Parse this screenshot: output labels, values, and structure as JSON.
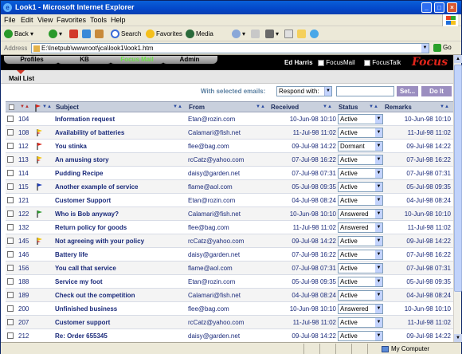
{
  "window": {
    "title": "Look1 - Microsoft Internet Explorer"
  },
  "menu": [
    "File",
    "Edit",
    "View",
    "Favorites",
    "Tools",
    "Help"
  ],
  "toolbar": {
    "back": "Back",
    "search": "Search",
    "favorites": "Favorites",
    "media": "Media"
  },
  "address": {
    "label": "Address",
    "url": "E:\\Inetpub\\wwwroot\\jca\\look1\\look1.htm",
    "go": "Go"
  },
  "app": {
    "tabs": [
      "Profiles",
      "KB",
      "Focus Mail",
      "Admin"
    ],
    "active_tab": "Focus Mail",
    "user": "Ed Harris",
    "links": [
      "FocusMail",
      "FocusTalk"
    ],
    "logo": "Focus",
    "section": "Mail List",
    "with_selected": "With selected emails:",
    "respond_select": "Respond with:",
    "set_button": "Set...",
    "doit_button": "Do It"
  },
  "columns": {
    "subject": "Subject",
    "from": "From",
    "received": "Received",
    "status": "Status",
    "remarks": "Remarks"
  },
  "colors": {
    "flag_red": "#d8261b",
    "flag_yellow": "#f2c200",
    "flag_blue": "#1a3ab8",
    "flag_green": "#2a9a2a",
    "header_bg": "#c9d0dd",
    "accent_link": "#1a2a7a"
  },
  "emails": [
    {
      "id": "104",
      "flag": "",
      "subject": "Information request",
      "from": "Etan@rozin.com",
      "received": "10-Jun-98 10:10",
      "status": "Active",
      "remarks": "10-Jun-98 10:10"
    },
    {
      "id": "108",
      "flag": "yellow-red",
      "subject": "Availability of batteries",
      "from": "Calamari@fish.net",
      "received": "11-Jul-98 11:02",
      "status": "Active",
      "remarks": "11-Jul-98 11:02"
    },
    {
      "id": "112",
      "flag": "red",
      "subject": "You stinka",
      "from": "flee@bag.com",
      "received": "09-Jul-98 14:22",
      "status": "Dormant",
      "remarks": "09-Jul-98 14:22"
    },
    {
      "id": "113",
      "flag": "yellow-red",
      "subject": "An amusing story",
      "from": "rcCatz@yahoo.com",
      "received": "07-Jul-98 16:22",
      "status": "Active",
      "remarks": "07-Jul-98 16:22"
    },
    {
      "id": "114",
      "flag": "",
      "subject": "Pudding Recipe",
      "from": "daisy@garden.net",
      "received": "07-Jul-98 07:31",
      "status": "Active",
      "remarks": "07-Jul-98 07:31"
    },
    {
      "id": "115",
      "flag": "blue",
      "subject": "Another example of service",
      "from": "flame@aol.com",
      "received": "05-Jul-98 09:35",
      "status": "Active",
      "remarks": "05-Jul-98 09:35"
    },
    {
      "id": "121",
      "flag": "",
      "subject": "Customer Support",
      "from": "Etan@rozin.com",
      "received": "04-Jul-98 08:24",
      "status": "Active",
      "remarks": "04-Jul-98 08:24"
    },
    {
      "id": "122",
      "flag": "green",
      "subject": "Who is Bob anyway?",
      "from": "Calamari@fish.net",
      "received": "10-Jun-98 10:10",
      "status": "Answered",
      "remarks": "10-Jun-98 10:10"
    },
    {
      "id": "132",
      "flag": "",
      "subject": "Return policy for goods",
      "from": "flee@bag.com",
      "received": "11-Jul-98 11:02",
      "status": "Answered",
      "remarks": "11-Jul-98 11:02"
    },
    {
      "id": "145",
      "flag": "yellow-red",
      "subject": "Not agreeing with your policy",
      "from": "rcCatz@yahoo.com",
      "received": "09-Jul-98 14:22",
      "status": "Active",
      "remarks": "09-Jul-98 14:22"
    },
    {
      "id": "146",
      "flag": "",
      "subject": "Battery life",
      "from": "daisy@garden.net",
      "received": "07-Jul-98 16:22",
      "status": "Active",
      "remarks": "07-Jul-98 16:22"
    },
    {
      "id": "156",
      "flag": "",
      "subject": "You call that service",
      "from": "flame@aol.com",
      "received": "07-Jul-98 07:31",
      "status": "Active",
      "remarks": "07-Jul-98 07:31"
    },
    {
      "id": "188",
      "flag": "",
      "subject": "Service my foot",
      "from": "Etan@rozin.com",
      "received": "05-Jul-98 09:35",
      "status": "Active",
      "remarks": "05-Jul-98 09:35"
    },
    {
      "id": "189",
      "flag": "",
      "subject": "Check out the competition",
      "from": "Calamari@fish.net",
      "received": "04-Jul-98 08:24",
      "status": "Active",
      "remarks": "04-Jul-98 08:24"
    },
    {
      "id": "200",
      "flag": "",
      "subject": "Unfinished business",
      "from": "flee@bag.com",
      "received": "10-Jun-98 10:10",
      "status": "Answered",
      "remarks": "10-Jun-98 10:10"
    },
    {
      "id": "207",
      "flag": "",
      "subject": "Customer support",
      "from": "rcCatz@yahoo.com",
      "received": "11-Jul-98 11:02",
      "status": "Active",
      "remarks": "11-Jul-98 11:02"
    },
    {
      "id": "212",
      "flag": "",
      "subject": "Re: Order 655345",
      "from": "daisy@garden.net",
      "received": "09-Jul-98 14:22",
      "status": "Active",
      "remarks": "09-Jul-98 14:22"
    }
  ],
  "statusbar": {
    "zone": "My Computer"
  }
}
